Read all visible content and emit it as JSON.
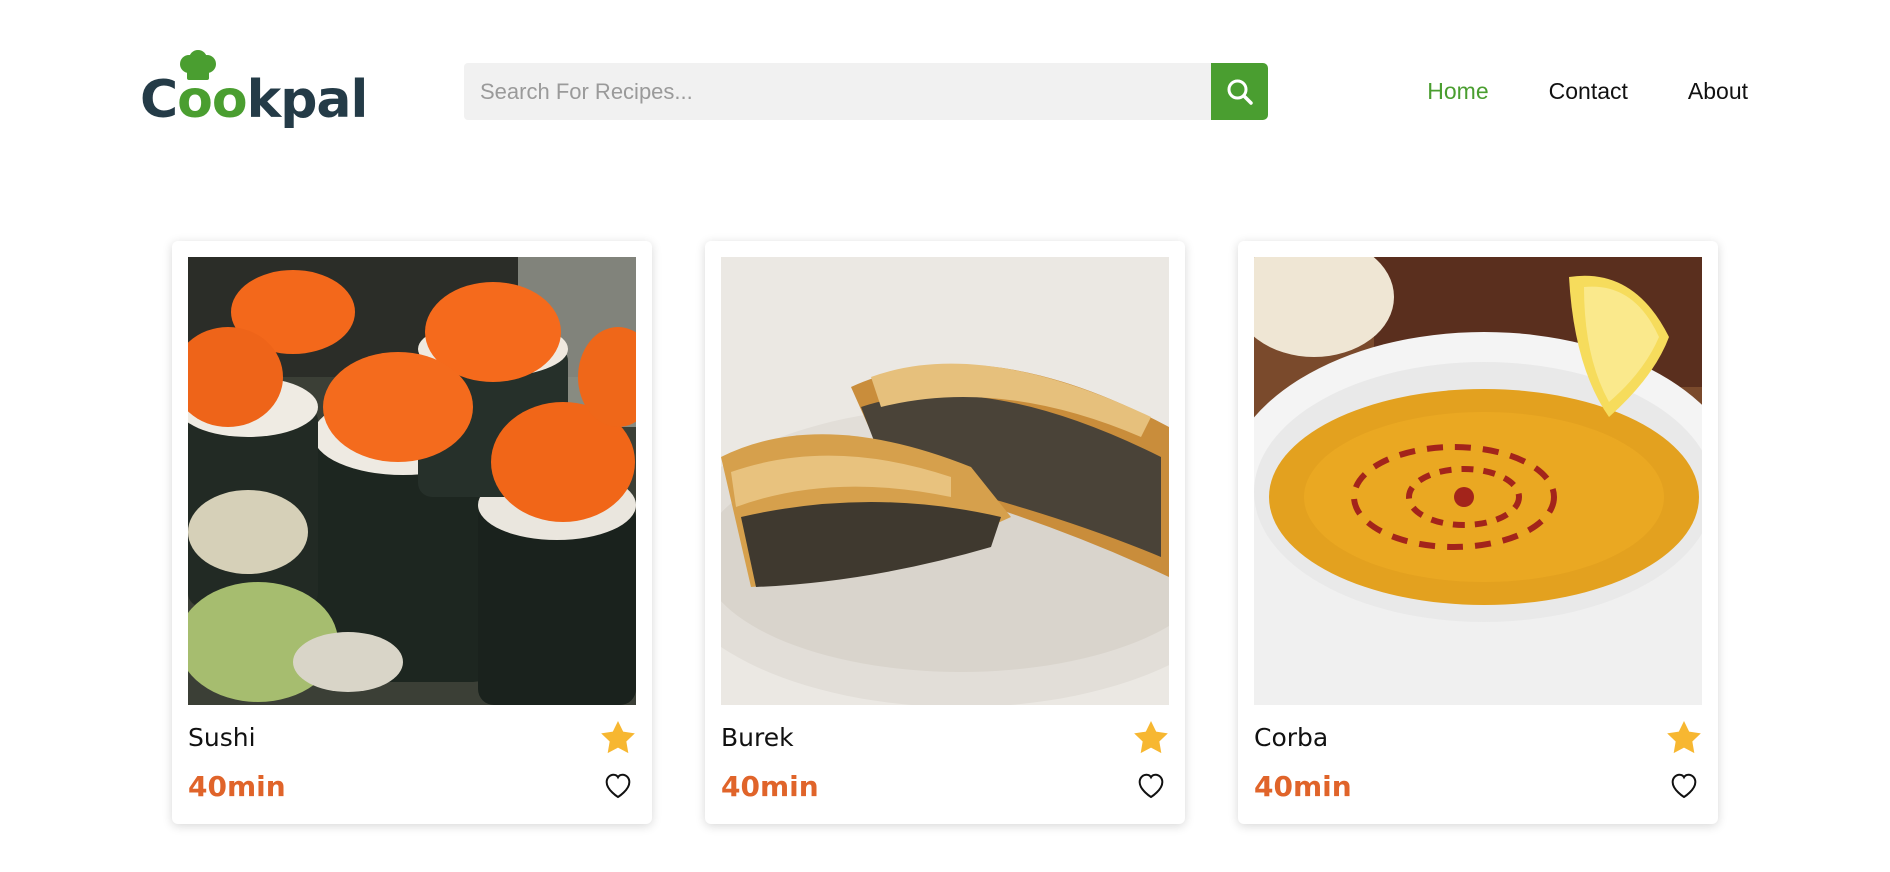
{
  "brand": {
    "name_prefix": "C",
    "name_oo": "oo",
    "name_suffix": "kpal",
    "logo_icon": "chef-hat-icon"
  },
  "search": {
    "placeholder": "Search For Recipes...",
    "value": "",
    "button_icon": "search-icon"
  },
  "nav": {
    "items": [
      {
        "label": "Home",
        "active": true
      },
      {
        "label": "Contact",
        "active": false
      },
      {
        "label": "About",
        "active": false
      }
    ]
  },
  "recipes": [
    {
      "title": "Sushi",
      "time": "40min",
      "image": "sushi-photo"
    },
    {
      "title": "Burek",
      "time": "40min",
      "image": "burek-photo"
    },
    {
      "title": "Corba",
      "time": "40min",
      "image": "corba-soup-photo"
    }
  ],
  "colors": {
    "accent": "#4a9e30",
    "time": "#e0642a",
    "star": "#f7b731",
    "logo_dark": "#243b47"
  }
}
